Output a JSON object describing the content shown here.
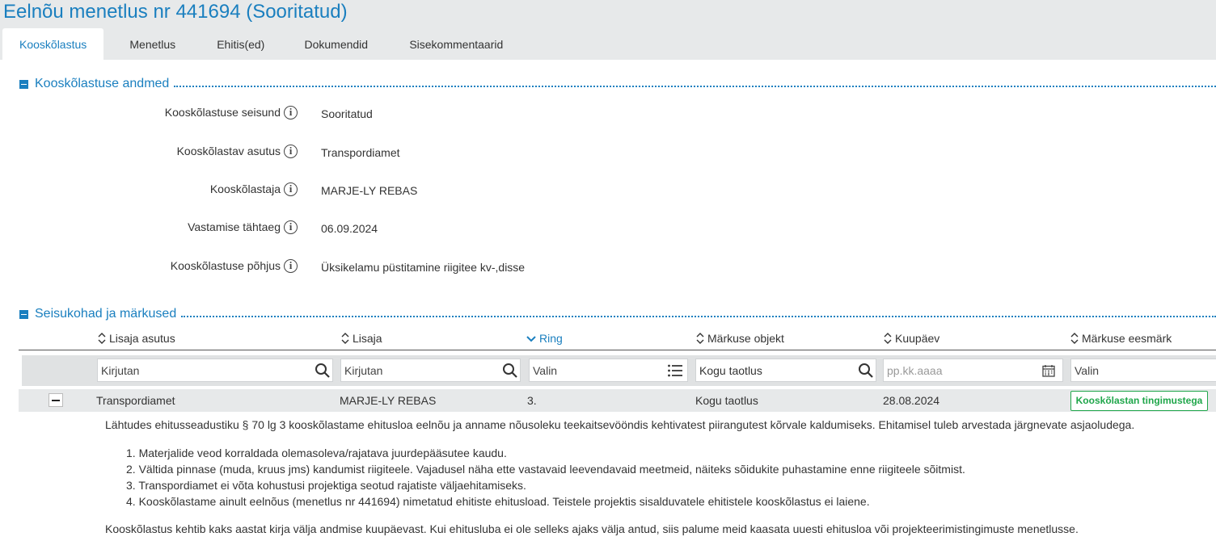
{
  "page": {
    "title": "Eelnõu menetlus nr 441694 (Sooritatud)"
  },
  "tabs": [
    {
      "label": "Kooskõlastus",
      "active": true
    },
    {
      "label": "Menetlus"
    },
    {
      "label": "Ehitis(ed)"
    },
    {
      "label": "Dokumendid"
    },
    {
      "label": "Sisekommentaarid"
    }
  ],
  "section1": {
    "title": "Kooskõlastuse andmed",
    "fields": [
      {
        "label": "Kooskõlastuse seisund",
        "value": "Sooritatud"
      },
      {
        "label": "Kooskõlastav asutus",
        "value": "Transpordiamet"
      },
      {
        "label": "Kooskõlastaja",
        "value": "MARJE-LY REBAS"
      },
      {
        "label": "Vastamise tähtaeg",
        "value": "06.09.2024"
      },
      {
        "label": "Kooskõlastuse põhjus",
        "value": "Üksikelamu püstitamine riigitee kv-,disse"
      }
    ]
  },
  "section2": {
    "title": "Seisukohad ja märkused",
    "columns": [
      {
        "label": "Lisaja asutus"
      },
      {
        "label": "Lisaja"
      },
      {
        "label": "Ring"
      },
      {
        "label": "Märkuse objekt"
      },
      {
        "label": "Kuupäev"
      },
      {
        "label": "Märkuse eesmärk"
      }
    ],
    "filters": {
      "lisaja_asutus": {
        "placeholder": "Kirjutan"
      },
      "lisaja": {
        "placeholder": "Kirjutan"
      },
      "ring": {
        "placeholder": "Valin"
      },
      "markuse_objekt": {
        "value": "Kogu taotlus"
      },
      "kuupaev": {
        "placeholder": "pp.kk.aaaa"
      },
      "markuse_eesmark": {
        "placeholder": "Valin"
      }
    },
    "row": {
      "lisaja_asutus": "Transpordiamet",
      "lisaja": "MARJE-LY REBAS",
      "ring": "3.",
      "markuse_objekt": "Kogu taotlus",
      "kuupaev": "28.08.2024",
      "markuse_eesmark": "Kooskõlastan tingimustega",
      "status_color": "#1fa64a"
    },
    "detail": {
      "intro": "Lähtudes ehitusseadustiku § 70 lg 3 kooskõlastame ehitusloa eelnõu ja anname nõusoleku teekaitsevööndis kehtivatest piirangutest kõrvale kaldumiseks. Ehitamisel tuleb arvestada järgnevate asjaoludega.",
      "items": [
        "1. Materjalide veod korraldada olemasoleva/rajatava juurdepääsutee kaudu.",
        "2. Vältida pinnase (muda, kruus jms) kandumist riigiteele. Vajadusel näha ette vastavaid leevendavaid meetmeid, näiteks sõidukite puhastamine enne riigiteele sõitmist.",
        "3. Transpordiamet ei võta kohustusi projektiga seotud rajatiste väljaehitamiseks.",
        "4. Kooskõlastame ainult eelnõus (menetlus nr 441694) nimetatud ehitiste ehitusload. Teistele projektis sisalduvatele ehitistele kooskõlastus ei laiene."
      ],
      "outro": "Kooskõlastus kehtib kaks aastat kirja välja andmise kuupäevast. Kui ehitusluba ei ole selleks ajaks välja antud, siis palume meid kaasata uuesti ehitusloa või projekteerimistingimuste menetlusse."
    }
  },
  "colors": {
    "accent": "#1a7fbf",
    "header_bg": "#e7e9ea",
    "success": "#1fa64a"
  }
}
